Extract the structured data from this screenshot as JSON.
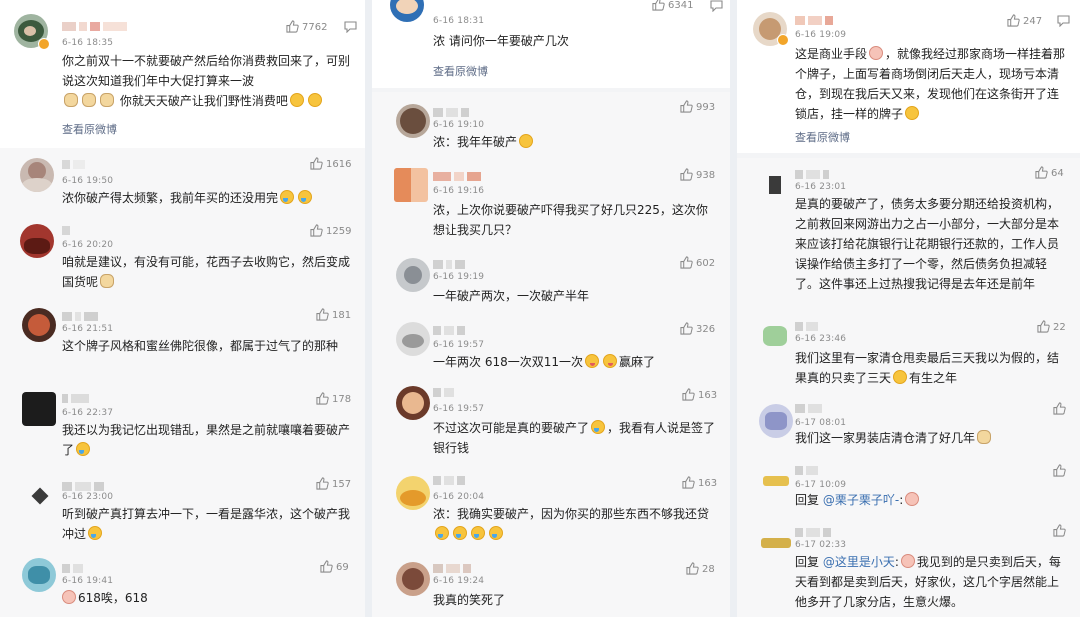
{
  "colors": {
    "link": "#5d6b86",
    "mention": "#3a6fb0",
    "like": "#8a8a8a",
    "date": "#8c8c8c"
  },
  "actions": {
    "view_original": "查看原微博"
  },
  "columns": [
    {
      "comments": [
        {
          "date": "6-16 18:35",
          "likes": "7762",
          "text": "你之前双十一不就要破产然后给你消费救回来了，可别说这次知道我们年中大促打算来一波",
          "text2": "你就天天破产让我们野性消费吧",
          "view": true
        },
        {
          "date": "6-16 19:50",
          "likes": "1616",
          "text": "浓你破产得太频繁，我前年买的还没用完"
        },
        {
          "date": "6-16 20:20",
          "likes": "1259",
          "text": "咱就是建议，有没有可能，花西子去收购它，然后变成国货呢"
        },
        {
          "date": "6-16 21:51",
          "likes": "181",
          "text": "这个牌子风格和蜜丝佛陀很像，都属于过气了的那种"
        },
        {
          "date": "6-16 22:37",
          "likes": "178",
          "text": "我还以为我记忆出现错乱，果然是之前就嚷嚷着要破产了"
        },
        {
          "date": "6-16 23:00",
          "likes": "157",
          "text": "听到破产真打算去冲一下，一看是露华浓，这个破产我冲过"
        },
        {
          "date": "6-16 19:41",
          "likes": "69",
          "text": "618唉，618"
        }
      ]
    },
    {
      "comments": [
        {
          "date": "6-16 18:31",
          "likes": "6341",
          "text": "浓 请问你一年要破产几次",
          "view": true
        },
        {
          "date": "6-16 19:10",
          "likes": "993",
          "text": "浓：我年年破产"
        },
        {
          "date": "6-16 19:16",
          "likes": "938",
          "text": "浓，上次你说要破产吓得我买了好几只225，这次你想让我买几只？"
        },
        {
          "date": "6-16 19:19",
          "likes": "602",
          "text": "一年破产两次，一次破产半年"
        },
        {
          "date": "6-16 19:57",
          "likes": "326",
          "text": "一年两次 618一次双11一次",
          "text2": "麻了",
          "text2_prefix": "赢"
        },
        {
          "date": "6-16 19:57",
          "likes": "163",
          "text": "不过这次可能是真的要破产了",
          "text2": "，我看有人说是签了银行钱"
        },
        {
          "date": "6-16 20:04",
          "likes": "163",
          "text": "浓：我确实要破产，因为你买的那些东西不够我还贷"
        },
        {
          "date": "6-16 19:24",
          "likes": "28",
          "text": "我真的笑死了"
        }
      ]
    },
    {
      "comments": [
        {
          "date": "6-16 19:09",
          "likes": "247",
          "text": "这是商业手段",
          "text2": "，就像我经过那家商场一样挂着那个牌子，上面写着商场倒闭后天走人，现场亏本清仓，到现在我后天又来，发现他们在这条街开了连锁店，挂一样的牌子",
          "view": true
        },
        {
          "date": "6-16 23:01",
          "likes": "64",
          "text": "是真的要破产了，债务太多要分期还给投资机构，之前救回来网游出力之占一小部分，一大部分是本来应该打给花旗银行让花期银行还款的，工作人员误操作给债主多打了一个零，然后债务负担减轻了。这件事还上过热搜我记得是去年还是前年"
        },
        {
          "date": "6-16 23:46",
          "likes": "22",
          "text": "我们这里有一家清仓甩卖最后三天我以为假的，结果真的只卖了三天",
          "text2": "有生之年"
        },
        {
          "date": "6-17 08:01",
          "likes": "",
          "text": "我们这一家男装店清仓清了好几年"
        },
        {
          "date": "6-17 10:09",
          "likes": "",
          "reply_prefix": "回复",
          "mention": "@栗子栗子吖-",
          "text": ":"
        },
        {
          "date": "6-17 02:33",
          "likes": "",
          "reply_prefix": "回复",
          "mention": "@这里是小天",
          "text": ":",
          "text2": "我见到的是只卖到后天，每天看到都是卖到后天，好家伙，这几个字居然能上他多开了几家分店，生意火爆。"
        }
      ]
    }
  ]
}
